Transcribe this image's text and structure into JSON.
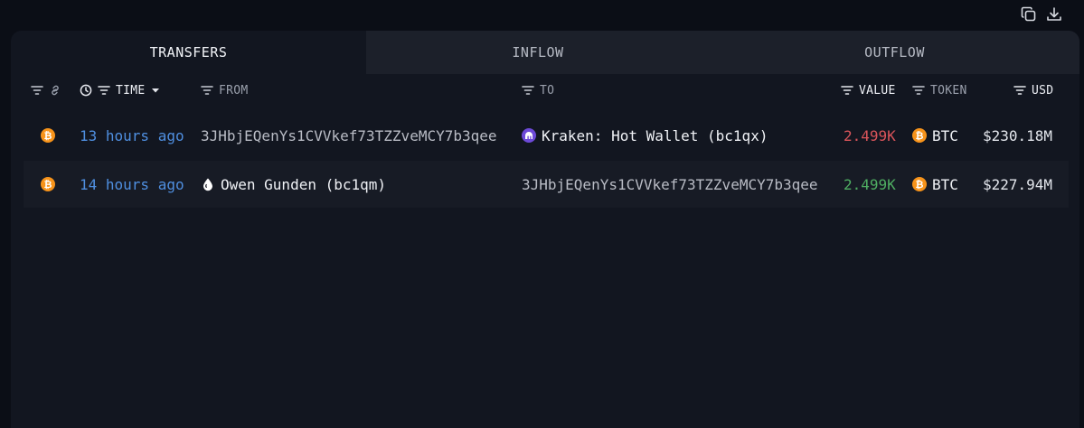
{
  "tabs": [
    {
      "label": "TRANSFERS",
      "active": true
    },
    {
      "label": "INFLOW",
      "active": false
    },
    {
      "label": "OUTFLOW",
      "active": false
    }
  ],
  "columns": {
    "time": "TIME",
    "from": "FROM",
    "to": "TO",
    "value": "VALUE",
    "token": "TOKEN",
    "usd": "USD"
  },
  "rows": [
    {
      "time": "13 hours ago",
      "from": "3JHbjEQenYs1CVVkef73TZZveMCY7b3qee",
      "to": "Kraken: Hot Wallet (bc1qx)",
      "value": "2.499K",
      "value_direction": "out",
      "token": "BTC",
      "usd": "$230.18M"
    },
    {
      "time": "14 hours ago",
      "from": "Owen Gunden (bc1qm)",
      "to": "3JHbjEQenYs1CVVkef73TZZveMCY7b3qee",
      "value": "2.499K",
      "value_direction": "in",
      "token": "BTC",
      "usd": "$227.94M"
    }
  ],
  "icons": {
    "top_actions": [
      "copy-icon",
      "download-icon"
    ],
    "chain": "bitcoin-icon",
    "kraken": "kraken-icon",
    "owen": "drop-icon"
  },
  "colors": {
    "background": "#0b0e16",
    "panel": "#121620",
    "time_link": "#4f8fe0",
    "value_out": "#d9545a",
    "value_in": "#4fae62",
    "btc": "#f7931a",
    "kraken": "#6d4ad8"
  }
}
